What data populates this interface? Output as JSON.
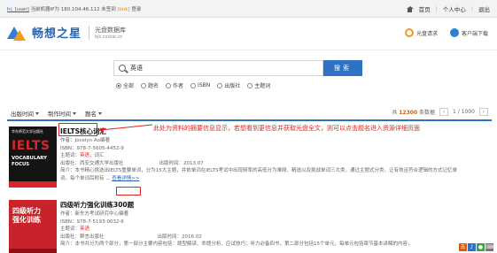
{
  "topbar": {
    "notice_link": "hi, [user]",
    "notice_mid": "当前机器IP为",
    "ip": "180.104.46.112",
    "notice_tail": "未签到",
    "notice_hl": "[link]",
    "notice_end": "登录",
    "home": "首页",
    "user_center": "个人中心",
    "exit": "退出"
  },
  "header": {
    "logo_text": "畅想之星",
    "logo_sub_cn": "光盘数据库",
    "logo_sub_en": "bjc.cxstar.cn",
    "disc_request": "光盘请求",
    "client_download": "客户端下载"
  },
  "search": {
    "query": "英语",
    "button": "搜索",
    "options": [
      "全部",
      "题名",
      "作者",
      "ISBN",
      "出版社",
      "主题词"
    ],
    "selected": "全部"
  },
  "sortbar": {
    "sort_pubtime": "出版时间",
    "sort_maketime": "制作时间",
    "sort_title": "题名",
    "total_prefix": "共",
    "total": "12300",
    "total_suffix": "条数据",
    "page_current": "1",
    "page_total": "1000"
  },
  "results": [
    {
      "title": "IELTS核心词汇",
      "author": "作者：Jocelyn Ao编著",
      "isbn": "ISBN：978-7-5605-4452-9",
      "subject_label": "主题词：",
      "subject_a": "英语",
      "subject_b": "，词汇",
      "publisher": "出版社：西安交通大学出版社",
      "pub_time": "出版时间：2013.07",
      "desc": "简介：本书精心挑选出IELTS重要单词，分为15大主题，并依单词在IELTS考试中出现频率的高低分为难频、精选以及挑战单词三大类，通过主题式分类，让有效且符合逻辑的方式记忆单",
      "desc2": "词。每个单词后附有 ...",
      "detail": "查看详情>>"
    },
    {
      "title": "四级听力强化训练300题",
      "author": "作者：新东方考试研究中心编著",
      "isbn": "ISBN：978-7-5193-0032-6",
      "subject_label": "主题词：",
      "subject_a": "英语",
      "publisher": "出版社：群言出版社",
      "pub_time": "出版时间：2016.02",
      "desc": "简介：本书共分为两个部分，第一部分主要内容包括：题型解读、命题分析、应试技巧；听力必备四书，第二部分包括15个单元，每单元包括章节基本讲解的内容，"
    }
  ],
  "annotation": "此处为资料的摘要信息显示，若想看到更信息并获取光盘全文，则可以点击题名进入资源详细页面",
  "covers": {
    "cover1_pub": "华东师范大学出版社",
    "cover1_main": "IELTS",
    "cover1_sub1": "VOCABULARY",
    "cover1_sub2": "FOCUS",
    "cover2_title1": "四级听力",
    "cover2_title2": "强化训练"
  },
  "floaty": [
    "五",
    "♪",
    "●",
    "⌨"
  ]
}
